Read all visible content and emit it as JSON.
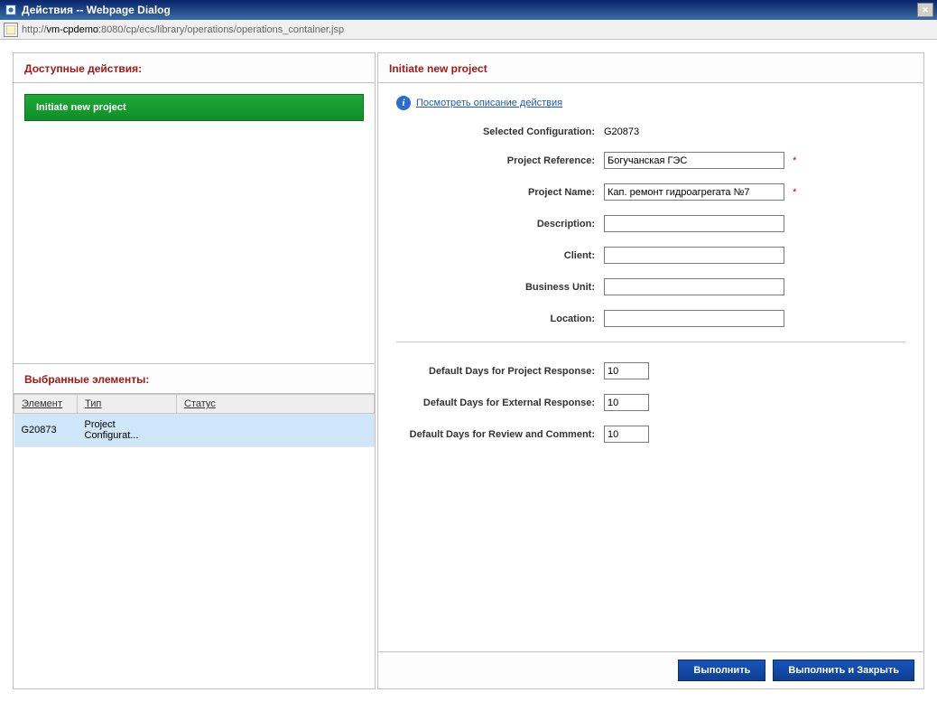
{
  "titlebar": {
    "title": "Действия -- Webpage Dialog",
    "close": "✕"
  },
  "addressbar": {
    "url_prefix": "http://",
    "url_host": "vm-cpdemo",
    "url_rest": ":8080/cp/ecs/library/operations/operations_container.jsp"
  },
  "left": {
    "available_header": "Доступные действия:",
    "action_label": "Initiate new project",
    "selected_header": "Выбранные элементы:",
    "cols": {
      "element": "Элемент",
      "type": "Тип",
      "status": "Статус"
    },
    "rows": [
      {
        "element": "G20873",
        "type": "Project Configurat...",
        "status": ""
      }
    ]
  },
  "right": {
    "header": "Initiate new project",
    "info_link": "Посмотреть описание действия",
    "fields": {
      "selected_config_label": "Selected Configuration:",
      "selected_config_value": "G20873",
      "project_ref_label": "Project Reference:",
      "project_ref_value": "Богучанская ГЭС",
      "project_name_label": "Project Name:",
      "project_name_value": "Кап. ремонт гидроагрегата №7",
      "description_label": "Description:",
      "description_value": "",
      "client_label": "Client:",
      "client_value": "",
      "business_unit_label": "Business Unit:",
      "business_unit_value": "",
      "location_label": "Location:",
      "location_value": "",
      "d_proj_resp_label": "Default Days for Project Response:",
      "d_proj_resp_value": "10",
      "d_ext_resp_label": "Default Days for External Response:",
      "d_ext_resp_value": "10",
      "d_review_label": "Default Days for Review and Comment:",
      "d_review_value": "10"
    },
    "required_mark": "*"
  },
  "footer": {
    "execute": "Выполнить",
    "execute_close": "Выполнить и Закрыть"
  }
}
